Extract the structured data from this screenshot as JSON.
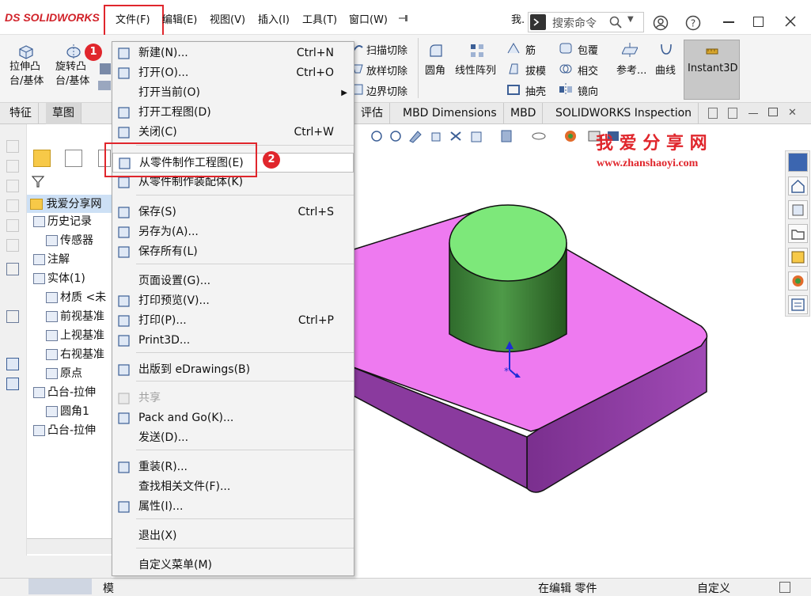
{
  "app": {
    "logo_text": "SOLIDWORKS",
    "logo_mark": "DS"
  },
  "menubar": {
    "items": [
      {
        "label": "文件(F)"
      },
      {
        "label": "编辑(E)"
      },
      {
        "label": "视图(V)"
      },
      {
        "label": "插入(I)"
      },
      {
        "label": "工具(T)"
      },
      {
        "label": "窗口(W)"
      }
    ],
    "pin_icon": "pin-icon",
    "truncated_label": "我."
  },
  "search": {
    "placeholder": "搜索命令",
    "icon": "search-icon"
  },
  "window_controls": {
    "user": "user-icon",
    "help": "help-icon",
    "minimize": "minimize-icon",
    "maximize": "maximize-icon",
    "close": "close-icon"
  },
  "toolbar": {
    "extrude_boss": "拉伸凸\n台/基体",
    "revolve_boss": "旋转凸\n台/基体",
    "sweep_cut": "扫描切除",
    "loft_cut": "放样切除",
    "boundary_cut": "边界切除",
    "fillet": "圆角",
    "linear_pattern": "线性阵列",
    "rib": "筋",
    "draft": "拔模",
    "shell": "抽壳",
    "wrap": "包覆",
    "intersect": "相交",
    "mirror": "镜向",
    "reference": "参考...",
    "curves": "曲线",
    "instant3d": "Instant3D"
  },
  "tabs": [
    {
      "label": "特征"
    },
    {
      "label": "草图"
    },
    {
      "label": "评估"
    },
    {
      "label": "MBD Dimensions"
    },
    {
      "label": "MBD"
    },
    {
      "label": "SOLIDWORKS Inspection"
    }
  ],
  "tree": {
    "root": "我爱分享网",
    "items": [
      {
        "label": "历史记录",
        "icon": "history-icon"
      },
      {
        "label": "传感器",
        "icon": "sensor-icon"
      },
      {
        "label": "注解",
        "icon": "annotation-icon"
      },
      {
        "label": "实体(1)",
        "icon": "solid-body-icon"
      },
      {
        "label": "材质 <未",
        "icon": "material-icon"
      },
      {
        "label": "前视基准",
        "icon": "plane-icon"
      },
      {
        "label": "上视基准",
        "icon": "plane-icon"
      },
      {
        "label": "右视基准",
        "icon": "plane-icon"
      },
      {
        "label": "原点",
        "icon": "origin-icon"
      },
      {
        "label": "凸台-拉伸",
        "icon": "boss-extrude-icon"
      },
      {
        "label": "圆角1",
        "icon": "fillet-icon"
      },
      {
        "label": "凸台-拉伸",
        "icon": "boss-extrude-icon"
      }
    ]
  },
  "file_menu": {
    "items": [
      {
        "label": "新建(N)...",
        "shortcut": "Ctrl+N",
        "icon": "new-document-icon"
      },
      {
        "label": "打开(O)...",
        "shortcut": "Ctrl+O",
        "icon": "open-folder-icon"
      },
      {
        "label": "打开当前(O)",
        "shortcut": "",
        "icon": "",
        "submenu": true
      },
      {
        "label": "打开工程图(D)",
        "shortcut": "",
        "icon": "drawing-icon"
      },
      {
        "label": "关闭(C)",
        "shortcut": "Ctrl+W",
        "icon": "close-document-icon"
      },
      {
        "label": "从零件制作工程图(E)",
        "shortcut": "",
        "icon": "make-drawing-icon",
        "highlighted": true
      },
      {
        "label": "从零件制作装配体(K)",
        "shortcut": "",
        "icon": "make-assembly-icon"
      },
      {
        "label": "保存(S)",
        "shortcut": "Ctrl+S",
        "icon": "save-icon"
      },
      {
        "label": "另存为(A)...",
        "shortcut": "",
        "icon": "save-as-icon"
      },
      {
        "label": "保存所有(L)",
        "shortcut": "",
        "icon": "save-all-icon"
      },
      {
        "label": "页面设置(G)...",
        "shortcut": "",
        "icon": ""
      },
      {
        "label": "打印预览(V)...",
        "shortcut": "",
        "icon": "print-preview-icon"
      },
      {
        "label": "打印(P)...",
        "shortcut": "Ctrl+P",
        "icon": "print-icon"
      },
      {
        "label": "Print3D...",
        "shortcut": "",
        "icon": "print3d-icon"
      },
      {
        "label": "出版到 eDrawings(B)",
        "shortcut": "",
        "icon": "edrawings-icon"
      },
      {
        "label": "共享",
        "shortcut": "",
        "icon": "share-icon",
        "disabled": true
      },
      {
        "label": "Pack and Go(K)...",
        "shortcut": "",
        "icon": "pack-and-go-icon"
      },
      {
        "label": "发送(D)...",
        "shortcut": "",
        "icon": ""
      },
      {
        "label": "重装(R)...",
        "shortcut": "",
        "icon": "reload-icon"
      },
      {
        "label": "查找相关文件(F)...",
        "shortcut": "",
        "icon": ""
      },
      {
        "label": "属性(I)...",
        "shortcut": "",
        "icon": "properties-icon"
      },
      {
        "label": "退出(X)",
        "shortcut": "",
        "icon": ""
      },
      {
        "label": "自定义菜单(M)",
        "shortcut": "",
        "icon": ""
      }
    ]
  },
  "annotations": {
    "badge1": "1",
    "badge2": "2"
  },
  "watermark": {
    "title": "我 爱 分 享 网",
    "url": "www.zhanshaoyi.com"
  },
  "statusbar": {
    "left_partial": "模",
    "editing": "在编辑 零件",
    "custom": "自定义"
  },
  "colors": {
    "accent_red": "#e0262c",
    "top_face": "#ee7af0",
    "side_face": "#8c3aa0",
    "cylinder_top": "#7de87a",
    "cylinder_side": "#3d8b38"
  }
}
